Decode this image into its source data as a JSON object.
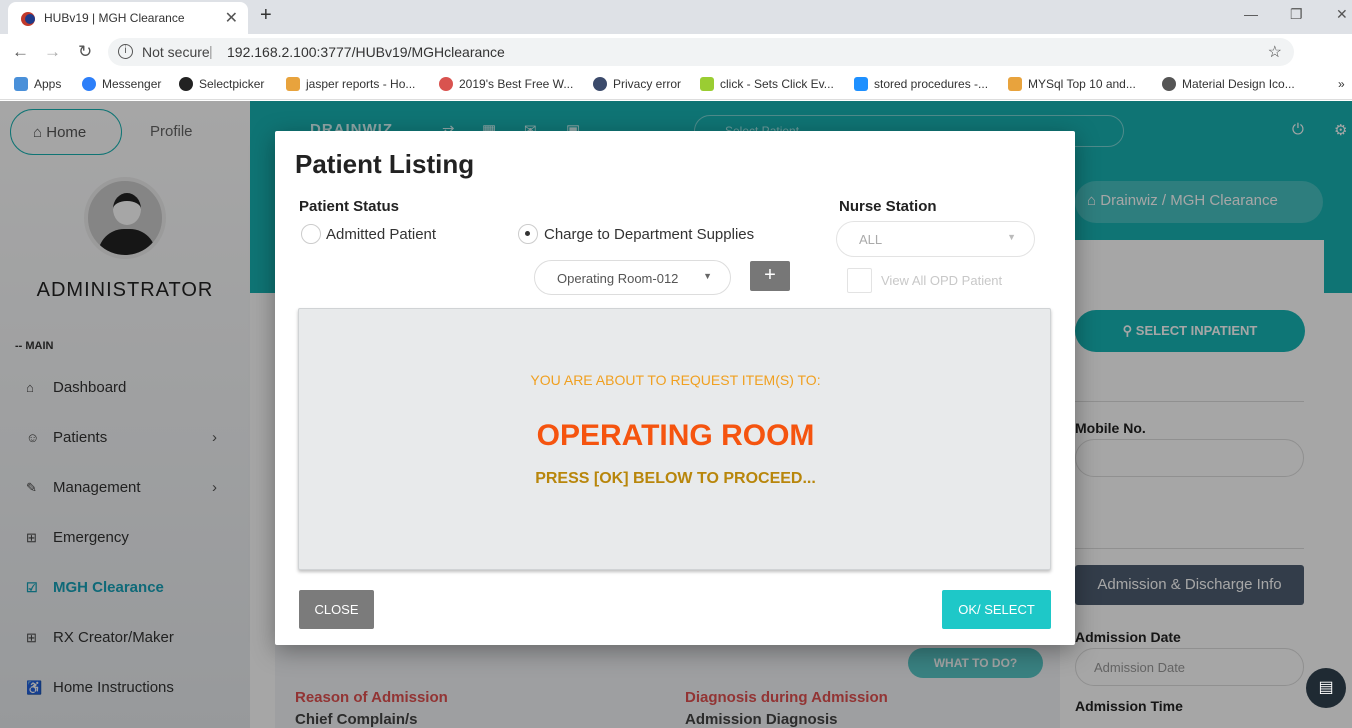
{
  "browser": {
    "tab_title": "HUBv19 | MGH Clearance",
    "not_secure": "Not secure",
    "url": "192.168.2.100:3777/HUBv19/MGHclearance",
    "bookmarks": [
      "Apps",
      "Messenger",
      "Selectpicker",
      "jasper reports - Ho...",
      "2019's Best Free W...",
      "Privacy error",
      "click - Sets Click Ev...",
      "stored procedures -...",
      "MYSql Top 10 and...",
      "Material Design Ico..."
    ]
  },
  "sidebar": {
    "home": "Home",
    "profile": "Profile",
    "user": "ADMINISTRATOR",
    "section": "-- MAIN",
    "items": [
      {
        "label": "Dashboard"
      },
      {
        "label": "Patients"
      },
      {
        "label": "Management"
      },
      {
        "label": "Emergency"
      },
      {
        "label": "MGH Clearance"
      },
      {
        "label": "RX Creator/Maker"
      },
      {
        "label": "Home Instructions"
      }
    ]
  },
  "topbar": {
    "brand": "DRAINWIZ",
    "select_placeholder": "Select Patient"
  },
  "breadcrumb": {
    "root": "Drainwiz",
    "sep": "/",
    "current": "MGH Clearance"
  },
  "right": {
    "select_inpatient": "SELECT INPATIENT",
    "mobile_label": "Mobile No.",
    "admission_info": "Admission & Discharge Info",
    "admission_date_label": "Admission Date",
    "admission_date_placeholder": "Admission Date",
    "admission_time_label": "Admission Time"
  },
  "content": {
    "what_to_do": "WHAT TO DO?",
    "reason": "Reason of Admission",
    "chief": "Chief Complain/s",
    "diagnosis": "Diagnosis during Admission",
    "admission_diag": "Admission Diagnosis"
  },
  "modal": {
    "title": "Patient Listing",
    "patient_status_label": "Patient Status",
    "radio_admitted": "Admitted Patient",
    "radio_charge": "Charge to Department Supplies",
    "department_selected": "Operating Room-012",
    "plus": "+",
    "nurse_station_label": "Nurse Station",
    "nurse_station_value": "ALL",
    "view_opd": "View All OPD Patient",
    "msg_line1": "YOU ARE ABOUT TO REQUEST ITEM(S) TO:",
    "msg_line2": "OPERATING ROOM",
    "msg_line3": "PRESS [OK] BELOW TO PROCEED...",
    "close": "CLOSE",
    "ok": "OK/ SELECT"
  }
}
